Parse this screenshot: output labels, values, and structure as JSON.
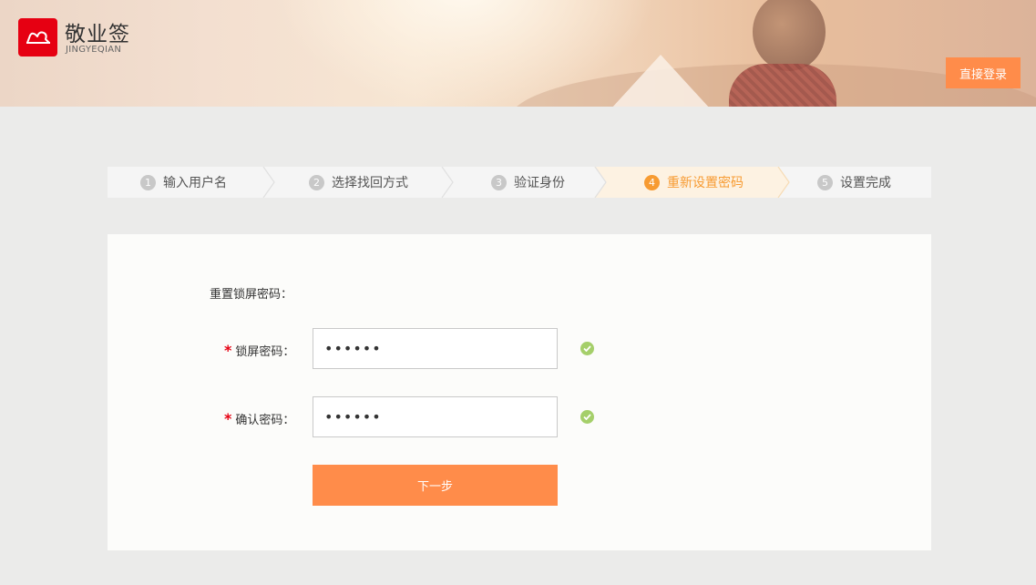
{
  "header": {
    "brand_name": "敬业签",
    "brand_sub": "JINGYEQIAN",
    "login_label": "直接登录"
  },
  "steps": [
    {
      "num": "1",
      "label": "输入用户名",
      "active": false
    },
    {
      "num": "2",
      "label": "选择找回方式",
      "active": false
    },
    {
      "num": "3",
      "label": "验证身份",
      "active": false
    },
    {
      "num": "4",
      "label": "重新设置密码",
      "active": true
    },
    {
      "num": "5",
      "label": "设置完成",
      "active": false
    }
  ],
  "form": {
    "section_label": "重置锁屏密码：",
    "required_mark": "*",
    "lock_password": {
      "label": "锁屏密码：",
      "value": "123456",
      "valid": true
    },
    "confirm_password": {
      "label": "确认密码：",
      "value": "123456",
      "valid": true
    },
    "next_label": "下一步"
  },
  "colors": {
    "accent": "#ff8c4a",
    "active_step": "#f79b32",
    "brand_red": "#e60012",
    "valid_green": "#a5cf6a"
  }
}
